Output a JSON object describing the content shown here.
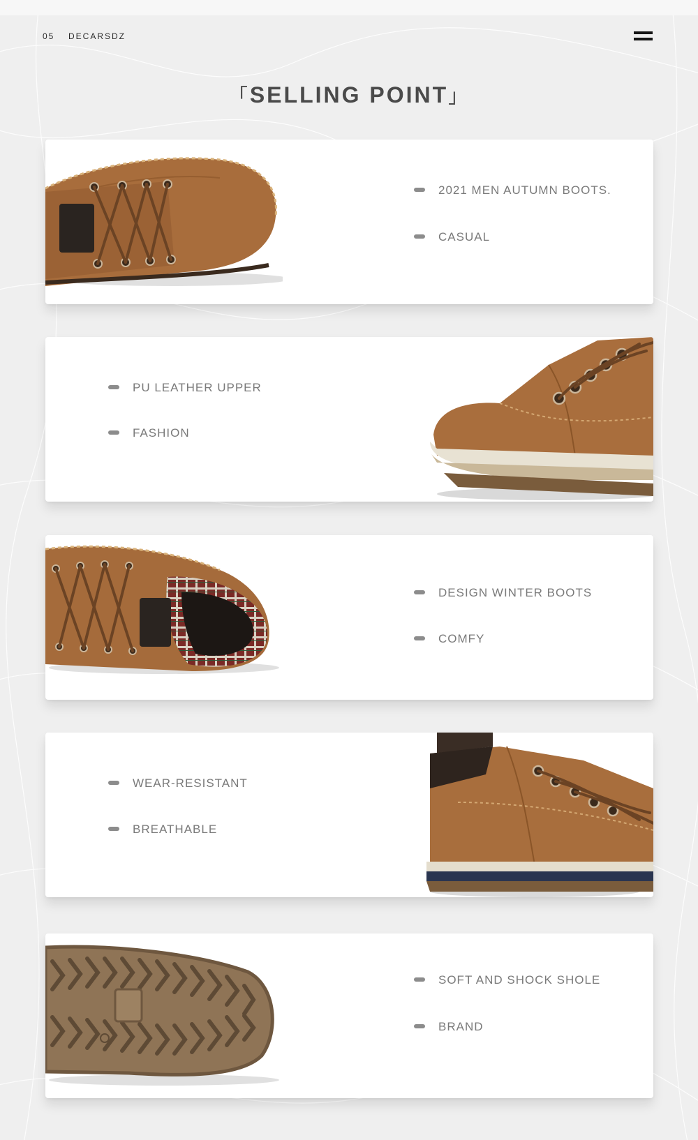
{
  "header": {
    "page_number": "05",
    "brand": "DECARSDZ",
    "menu_icon": "hamburger-menu-icon"
  },
  "title": {
    "open_bracket": "「",
    "text": "SELLING POINT",
    "close_bracket": "」"
  },
  "colors": {
    "background": "#f0f0f0",
    "card": "#ffffff",
    "text": "#7a7a7a",
    "title": "#4a4a4a",
    "leather": "#a8703f",
    "sole": "#8b7256"
  },
  "cards": [
    {
      "image_side": "left",
      "image": "boot-top-view-image",
      "features": [
        "2021 MEN AUTUMN BOOTS.",
        "CASUAL"
      ]
    },
    {
      "image_side": "right",
      "image": "boot-toe-side-image",
      "features": [
        "PU LEATHER UPPER",
        "FASHION"
      ]
    },
    {
      "image_side": "left",
      "image": "boot-plaid-lining-image",
      "features": [
        "DESIGN WINTER BOOTS",
        "COMFY"
      ]
    },
    {
      "image_side": "right",
      "image": "boot-heel-side-image",
      "features": [
        "WEAR-RESISTANT",
        "BREATHABLE"
      ]
    },
    {
      "image_side": "left",
      "image": "boot-outsole-image",
      "features": [
        "SOFT AND SHOCK SHOLE",
        "BRAND"
      ]
    }
  ]
}
